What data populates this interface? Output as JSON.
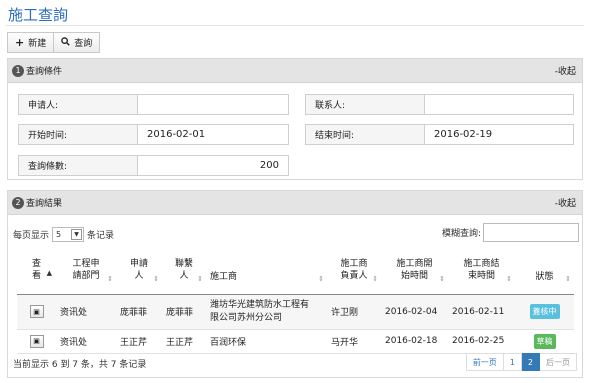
{
  "page": {
    "title": "施工查詢"
  },
  "toolbar": {
    "new_label": "新建",
    "query_label": "查詢",
    "new_icon": "plus-icon",
    "query_icon": "search-icon"
  },
  "conditions": {
    "number": "1",
    "title": "查詢條件",
    "collapse": "-收起",
    "applicant": {
      "label": "申请人:",
      "value": ""
    },
    "contact": {
      "label": "联系人:",
      "value": ""
    },
    "start_time": {
      "label": "开始时间:",
      "value": "2016-02-01"
    },
    "end_time": {
      "label": "结束时间:",
      "value": "2016-02-19"
    },
    "max_results": {
      "label": "查詢條數:",
      "value": "200"
    }
  },
  "results": {
    "number": "2",
    "title": "查詢結果",
    "collapse": "-收起",
    "page_size_prefix": "每页显示",
    "page_size": "5",
    "page_size_suffix": "条记录",
    "search_label": "模糊查詢:",
    "columns": [
      {
        "line1": "查",
        "line2": "看"
      },
      {
        "line1": "工程申",
        "line2": "請部門"
      },
      {
        "line1": "申請",
        "line2": "人"
      },
      {
        "line1": "聯繫",
        "line2": "人"
      },
      {
        "line1": "施工商",
        "line2": ""
      },
      {
        "line1": "施工商",
        "line2": "負責人"
      },
      {
        "line1": "施工商開",
        "line2": "始時間"
      },
      {
        "line1": "施工商結",
        "line2": "束時間"
      },
      {
        "line1": "狀態",
        "line2": ""
      }
    ],
    "rows": [
      {
        "dept": "资讯处",
        "applicant": "庞菲菲",
        "contact": "庞菲菲",
        "contractor_1": "潍坊华光建筑防水工程有",
        "contractor_2": "限公司苏州分公司",
        "manager": "许卫刚",
        "start": "2016-02-04",
        "end": "2016-02-11",
        "status": "蓋核中",
        "status_color": "#5bc0de"
      },
      {
        "dept": "资讯处",
        "applicant": "王正芹",
        "contact": "王正芹",
        "contractor_1": "百润环保",
        "contractor_2": "",
        "manager": "马开华",
        "start": "2016-02-18",
        "end": "2016-02-25",
        "status": "草稿",
        "status_color": "#5cb85c"
      }
    ],
    "info": "当前显示 6 到 7 条，共 7 条记录",
    "pager": {
      "prev": "前一页",
      "p1": "1",
      "p2": "2",
      "next": "后一页"
    }
  },
  "colors": {
    "accent": "#2a6ebb",
    "active_page": "#337ab7"
  }
}
